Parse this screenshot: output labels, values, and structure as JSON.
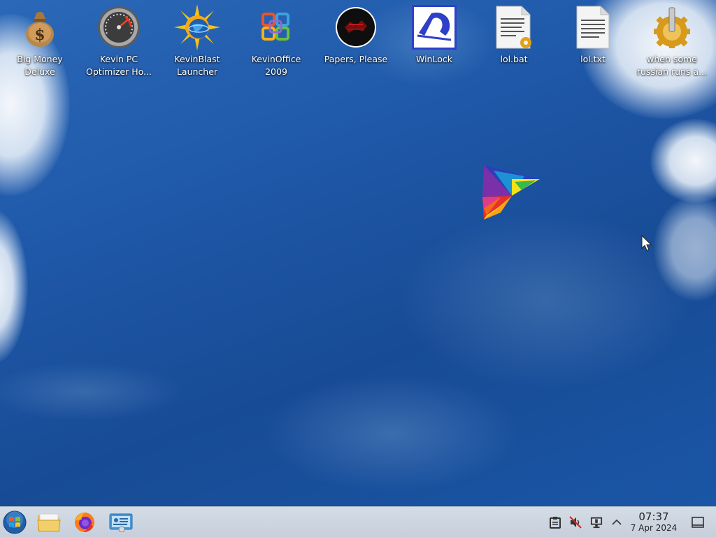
{
  "desktop": {
    "icons": [
      {
        "label": "Big Money\nDeluxe",
        "icon": "money-bag-icon"
      },
      {
        "label": "Kevin PC\nOptimizer Ho...",
        "icon": "speedometer-icon"
      },
      {
        "label": "KevinBlast\nLauncher",
        "icon": "sun-globe-icon"
      },
      {
        "label": "KevinOffice\n2009",
        "icon": "office-logo-icon"
      },
      {
        "label": "Papers, Please",
        "icon": "papers-please-icon"
      },
      {
        "label": "WinLock",
        "icon": "winlock-icon"
      },
      {
        "label": "lol.bat",
        "icon": "batch-file-icon"
      },
      {
        "label": "lol.txt",
        "icon": "text-file-icon"
      },
      {
        "label": "when some\nrussian runs a...",
        "icon": "gear-icon"
      }
    ]
  },
  "wallpaper": {
    "subject": "kite-in-blue-sky"
  },
  "taskbar": {
    "start_icon": "start-orb-icon",
    "pinned": [
      {
        "icon": "file-manager-icon"
      },
      {
        "icon": "firefox-icon"
      },
      {
        "icon": "control-panel-icon"
      }
    ],
    "tray": [
      {
        "icon": "clipboard-icon"
      },
      {
        "icon": "volume-muted-icon"
      },
      {
        "icon": "display-icon"
      },
      {
        "icon": "chevron-up-icon"
      }
    ],
    "clock": {
      "time": "07:37",
      "date": "7 Apr 2024"
    },
    "show_desktop_icon": "show-desktop-icon"
  },
  "colors": {
    "sky": "#1f58a8",
    "taskbar": "#cdd5e0",
    "label_text": "#ffffff"
  }
}
